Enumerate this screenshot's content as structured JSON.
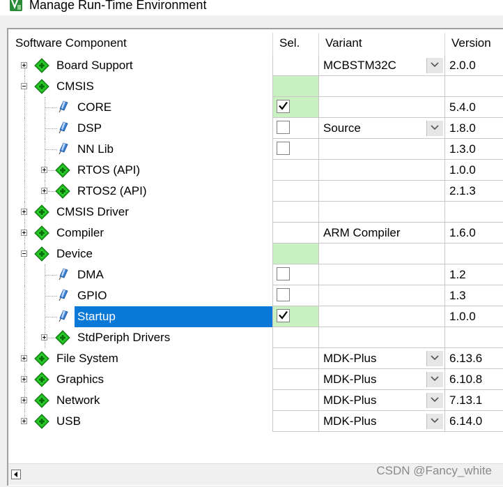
{
  "window": {
    "title": "Manage Run-Time Environment",
    "icon": "rte-manager-icon"
  },
  "columns": {
    "component": "Software Component",
    "sel": "Sel.",
    "variant": "Variant",
    "version": "Version"
  },
  "rows": [
    {
      "name": "Board Support",
      "expander": "plus",
      "icon": "gem-icon",
      "sel": "none",
      "variant": "MCBSTM32C",
      "dropdown": true,
      "version": "2.0.0"
    },
    {
      "name": "CMSIS",
      "expander": "minus",
      "icon": "gem-icon",
      "sel": "green",
      "variant": "",
      "dropdown": false,
      "version": ""
    },
    {
      "name": "CORE",
      "expander": "none",
      "icon": "pin-icon",
      "sel": "checked",
      "variant": "",
      "dropdown": false,
      "version": "5.4.0"
    },
    {
      "name": "DSP",
      "expander": "none",
      "icon": "pin-icon",
      "sel": "unchecked",
      "variant": "Source",
      "dropdown": true,
      "version": "1.8.0"
    },
    {
      "name": "NN Lib",
      "expander": "none",
      "icon": "pin-icon",
      "sel": "unchecked",
      "variant": "",
      "dropdown": false,
      "version": "1.3.0"
    },
    {
      "name": "RTOS (API)",
      "expander": "plus",
      "icon": "gem-icon",
      "sel": "none",
      "variant": "",
      "dropdown": false,
      "version": "1.0.0"
    },
    {
      "name": "RTOS2 (API)",
      "expander": "plus",
      "icon": "gem-icon",
      "sel": "none",
      "variant": "",
      "dropdown": false,
      "version": "2.1.3"
    },
    {
      "name": "CMSIS Driver",
      "expander": "plus",
      "icon": "gem-icon",
      "sel": "none",
      "variant": "",
      "dropdown": false,
      "version": ""
    },
    {
      "name": "Compiler",
      "expander": "plus",
      "icon": "gem-icon",
      "sel": "none",
      "variant": "ARM Compiler",
      "dropdown": false,
      "version": "1.6.0"
    },
    {
      "name": "Device",
      "expander": "minus",
      "icon": "gem-icon",
      "sel": "green",
      "variant": "",
      "dropdown": false,
      "version": ""
    },
    {
      "name": "DMA",
      "expander": "none",
      "icon": "pin-icon",
      "sel": "unchecked",
      "variant": "",
      "dropdown": false,
      "version": "1.2"
    },
    {
      "name": "GPIO",
      "expander": "none",
      "icon": "pin-icon",
      "sel": "unchecked",
      "variant": "",
      "dropdown": false,
      "version": "1.3"
    },
    {
      "name": "Startup",
      "expander": "none",
      "icon": "pin-icon",
      "sel": "checked",
      "variant": "",
      "dropdown": false,
      "version": "1.0.0",
      "selected": true
    },
    {
      "name": "StdPeriph Drivers",
      "expander": "plus",
      "icon": "gem-icon",
      "sel": "none",
      "variant": "",
      "dropdown": false,
      "version": ""
    },
    {
      "name": "File System",
      "expander": "plus",
      "icon": "gem-icon",
      "sel": "none",
      "variant": "MDK-Plus",
      "dropdown": true,
      "version": "6.13.6"
    },
    {
      "name": "Graphics",
      "expander": "plus",
      "icon": "gem-icon",
      "sel": "none",
      "variant": "MDK-Plus",
      "dropdown": true,
      "version": "6.10.8"
    },
    {
      "name": "Network",
      "expander": "plus",
      "icon": "gem-icon",
      "sel": "none",
      "variant": "MDK-Plus",
      "dropdown": true,
      "version": "7.13.1"
    },
    {
      "name": "USB",
      "expander": "plus",
      "icon": "gem-icon",
      "sel": "none",
      "variant": "MDK-Plus",
      "dropdown": true,
      "version": "6.14.0"
    }
  ],
  "watermark": "CSDN @Fancy_white",
  "colors": {
    "selection": "#0a78d7",
    "sel_green": "#c8f0c0",
    "gem": "#1fb41f"
  }
}
